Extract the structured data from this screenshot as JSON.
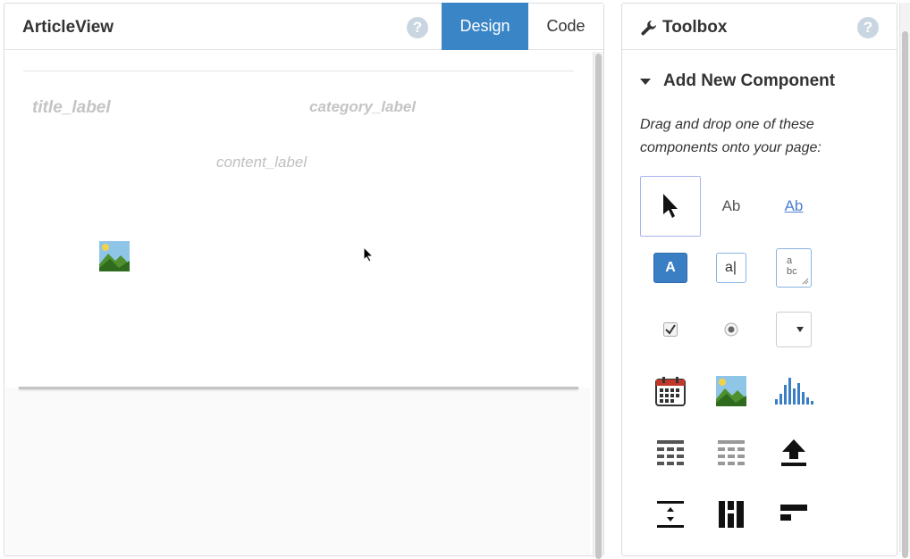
{
  "designer": {
    "title": "ArticleView",
    "tabs": [
      {
        "label": "Design",
        "active": true
      },
      {
        "label": "Code",
        "active": false
      }
    ],
    "labels": {
      "title": "title_label",
      "category": "category_label",
      "content": "content_label"
    }
  },
  "toolbox": {
    "title": "Toolbox",
    "section_title": "Add New Component",
    "instructions": "Drag and drop one of these components onto your page:",
    "components": [
      {
        "icon": "pointer-icon",
        "selected": true
      },
      {
        "icon": "label-ab-icon",
        "text": "Ab"
      },
      {
        "icon": "link-ab-icon",
        "text": "Ab"
      },
      {
        "icon": "button-a-icon",
        "text": "A"
      },
      {
        "icon": "textfield-icon",
        "text": "a"
      },
      {
        "icon": "textarea-icon",
        "text": "a bc"
      },
      {
        "icon": "checkbox-icon"
      },
      {
        "icon": "radio-icon"
      },
      {
        "icon": "dropdown-icon"
      },
      {
        "icon": "calendar-icon"
      },
      {
        "icon": "image-icon"
      },
      {
        "icon": "chart-icon"
      },
      {
        "icon": "table-icon"
      },
      {
        "icon": "table-light-icon"
      },
      {
        "icon": "upload-icon"
      },
      {
        "icon": "vertical-spacer-icon"
      },
      {
        "icon": "vertical-layout-icon"
      },
      {
        "icon": "horizontal-layout-icon"
      }
    ]
  },
  "colors": {
    "accent": "#3a85c6",
    "label_gray": "#c4c4c4",
    "selection_border": "#a9b3f2",
    "link_blue": "#4a7fd2"
  }
}
